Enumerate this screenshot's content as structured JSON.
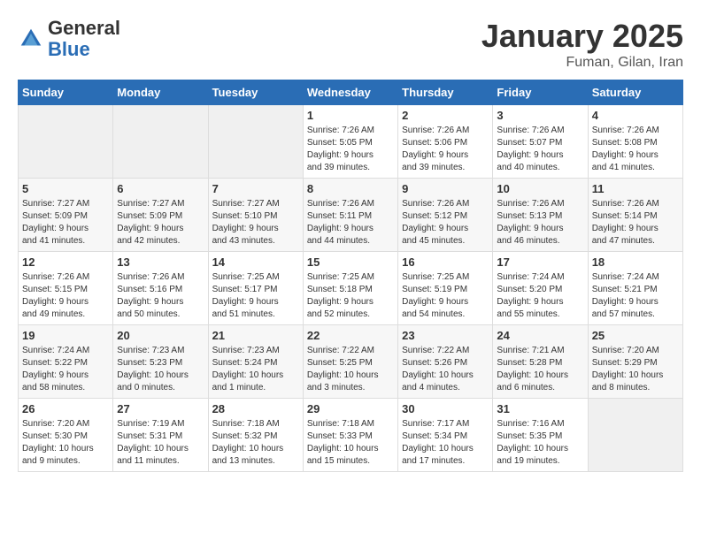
{
  "header": {
    "logo_general": "General",
    "logo_blue": "Blue",
    "month_title": "January 2025",
    "location": "Fuman, Gilan, Iran"
  },
  "weekdays": [
    "Sunday",
    "Monday",
    "Tuesday",
    "Wednesday",
    "Thursday",
    "Friday",
    "Saturday"
  ],
  "weeks": [
    [
      {
        "day": "",
        "info": ""
      },
      {
        "day": "",
        "info": ""
      },
      {
        "day": "",
        "info": ""
      },
      {
        "day": "1",
        "info": "Sunrise: 7:26 AM\nSunset: 5:05 PM\nDaylight: 9 hours\nand 39 minutes."
      },
      {
        "day": "2",
        "info": "Sunrise: 7:26 AM\nSunset: 5:06 PM\nDaylight: 9 hours\nand 39 minutes."
      },
      {
        "day": "3",
        "info": "Sunrise: 7:26 AM\nSunset: 5:07 PM\nDaylight: 9 hours\nand 40 minutes."
      },
      {
        "day": "4",
        "info": "Sunrise: 7:26 AM\nSunset: 5:08 PM\nDaylight: 9 hours\nand 41 minutes."
      }
    ],
    [
      {
        "day": "5",
        "info": "Sunrise: 7:27 AM\nSunset: 5:09 PM\nDaylight: 9 hours\nand 41 minutes."
      },
      {
        "day": "6",
        "info": "Sunrise: 7:27 AM\nSunset: 5:09 PM\nDaylight: 9 hours\nand 42 minutes."
      },
      {
        "day": "7",
        "info": "Sunrise: 7:27 AM\nSunset: 5:10 PM\nDaylight: 9 hours\nand 43 minutes."
      },
      {
        "day": "8",
        "info": "Sunrise: 7:26 AM\nSunset: 5:11 PM\nDaylight: 9 hours\nand 44 minutes."
      },
      {
        "day": "9",
        "info": "Sunrise: 7:26 AM\nSunset: 5:12 PM\nDaylight: 9 hours\nand 45 minutes."
      },
      {
        "day": "10",
        "info": "Sunrise: 7:26 AM\nSunset: 5:13 PM\nDaylight: 9 hours\nand 46 minutes."
      },
      {
        "day": "11",
        "info": "Sunrise: 7:26 AM\nSunset: 5:14 PM\nDaylight: 9 hours\nand 47 minutes."
      }
    ],
    [
      {
        "day": "12",
        "info": "Sunrise: 7:26 AM\nSunset: 5:15 PM\nDaylight: 9 hours\nand 49 minutes."
      },
      {
        "day": "13",
        "info": "Sunrise: 7:26 AM\nSunset: 5:16 PM\nDaylight: 9 hours\nand 50 minutes."
      },
      {
        "day": "14",
        "info": "Sunrise: 7:25 AM\nSunset: 5:17 PM\nDaylight: 9 hours\nand 51 minutes."
      },
      {
        "day": "15",
        "info": "Sunrise: 7:25 AM\nSunset: 5:18 PM\nDaylight: 9 hours\nand 52 minutes."
      },
      {
        "day": "16",
        "info": "Sunrise: 7:25 AM\nSunset: 5:19 PM\nDaylight: 9 hours\nand 54 minutes."
      },
      {
        "day": "17",
        "info": "Sunrise: 7:24 AM\nSunset: 5:20 PM\nDaylight: 9 hours\nand 55 minutes."
      },
      {
        "day": "18",
        "info": "Sunrise: 7:24 AM\nSunset: 5:21 PM\nDaylight: 9 hours\nand 57 minutes."
      }
    ],
    [
      {
        "day": "19",
        "info": "Sunrise: 7:24 AM\nSunset: 5:22 PM\nDaylight: 9 hours\nand 58 minutes."
      },
      {
        "day": "20",
        "info": "Sunrise: 7:23 AM\nSunset: 5:23 PM\nDaylight: 10 hours\nand 0 minutes."
      },
      {
        "day": "21",
        "info": "Sunrise: 7:23 AM\nSunset: 5:24 PM\nDaylight: 10 hours\nand 1 minute."
      },
      {
        "day": "22",
        "info": "Sunrise: 7:22 AM\nSunset: 5:25 PM\nDaylight: 10 hours\nand 3 minutes."
      },
      {
        "day": "23",
        "info": "Sunrise: 7:22 AM\nSunset: 5:26 PM\nDaylight: 10 hours\nand 4 minutes."
      },
      {
        "day": "24",
        "info": "Sunrise: 7:21 AM\nSunset: 5:28 PM\nDaylight: 10 hours\nand 6 minutes."
      },
      {
        "day": "25",
        "info": "Sunrise: 7:20 AM\nSunset: 5:29 PM\nDaylight: 10 hours\nand 8 minutes."
      }
    ],
    [
      {
        "day": "26",
        "info": "Sunrise: 7:20 AM\nSunset: 5:30 PM\nDaylight: 10 hours\nand 9 minutes."
      },
      {
        "day": "27",
        "info": "Sunrise: 7:19 AM\nSunset: 5:31 PM\nDaylight: 10 hours\nand 11 minutes."
      },
      {
        "day": "28",
        "info": "Sunrise: 7:18 AM\nSunset: 5:32 PM\nDaylight: 10 hours\nand 13 minutes."
      },
      {
        "day": "29",
        "info": "Sunrise: 7:18 AM\nSunset: 5:33 PM\nDaylight: 10 hours\nand 15 minutes."
      },
      {
        "day": "30",
        "info": "Sunrise: 7:17 AM\nSunset: 5:34 PM\nDaylight: 10 hours\nand 17 minutes."
      },
      {
        "day": "31",
        "info": "Sunrise: 7:16 AM\nSunset: 5:35 PM\nDaylight: 10 hours\nand 19 minutes."
      },
      {
        "day": "",
        "info": ""
      }
    ]
  ]
}
